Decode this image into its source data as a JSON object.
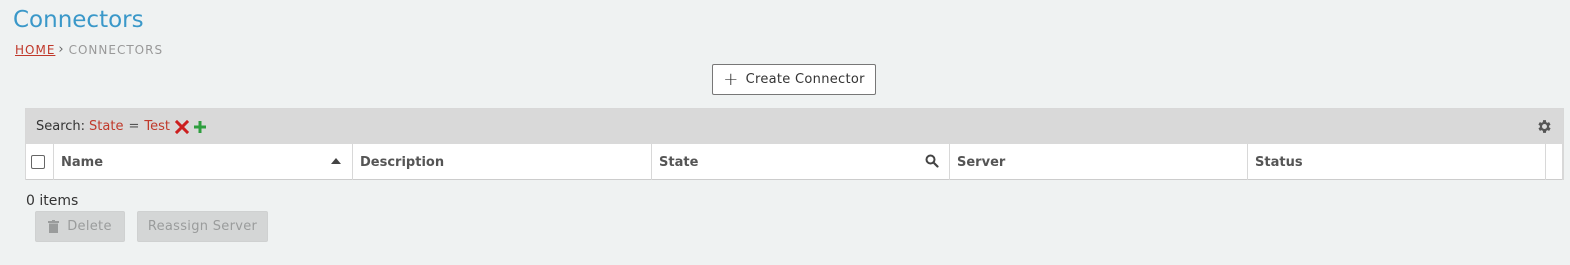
{
  "page": {
    "title": "Connectors"
  },
  "breadcrumb": {
    "home": "HOME",
    "current": "CONNECTORS"
  },
  "toolbar": {
    "create_label": "Create Connector"
  },
  "search": {
    "label": "Search:",
    "field": "State",
    "operator": "=",
    "value": "Test"
  },
  "table": {
    "columns": [
      "Name",
      "Description",
      "State",
      "Server",
      "Status"
    ],
    "sort_column": "Name",
    "sort_direction": "ascending",
    "rows": []
  },
  "footer": {
    "items_count": "0 items",
    "delete_label": "Delete",
    "reassign_label": "Reassign Server"
  },
  "colors": {
    "title": "#3a98c9",
    "token": "#c0392b",
    "remove_filter": "#cc1f1f",
    "add_filter": "#2e9e3e"
  }
}
